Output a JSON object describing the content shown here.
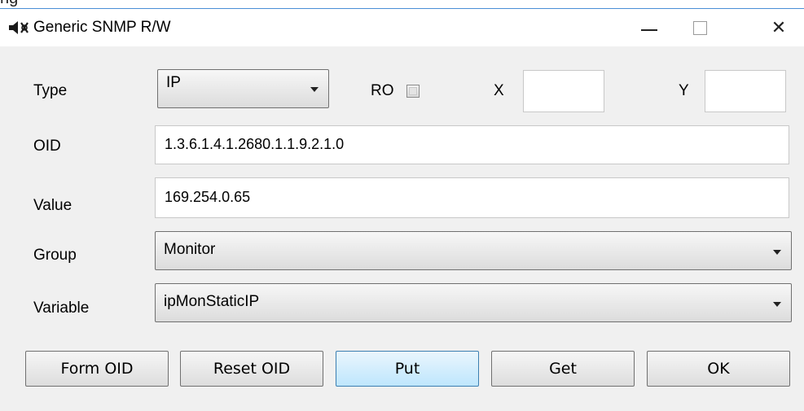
{
  "window": {
    "title": "Generic SNMP R/W",
    "controls": {
      "minimize": "minimize-icon",
      "maximize": "maximize-icon",
      "close": "close-icon",
      "close_glyph": "✕"
    }
  },
  "form": {
    "type": {
      "label": "Type",
      "value": "IP"
    },
    "ro": {
      "label": "RO",
      "checked": false
    },
    "x": {
      "label": "X",
      "value": ""
    },
    "y": {
      "label": "Y",
      "value": ""
    },
    "oid": {
      "label": "OID",
      "value": "1.3.6.1.4.1.2680.1.1.9.2.1.0"
    },
    "value": {
      "label": "Value",
      "value": "169.254.0.65"
    },
    "group": {
      "label": "Group",
      "value": "Monitor"
    },
    "variable": {
      "label": "Variable",
      "value": "ipMonStaticIP"
    }
  },
  "buttons": {
    "form_oid": "Form OID",
    "reset_oid": "Reset OID",
    "put": "Put",
    "get": "Get",
    "ok": "OK"
  },
  "colors": {
    "accent_border": "#4a8fd6",
    "default_button_top": "#eaf6fd",
    "default_button_bottom": "#bee6fd"
  }
}
